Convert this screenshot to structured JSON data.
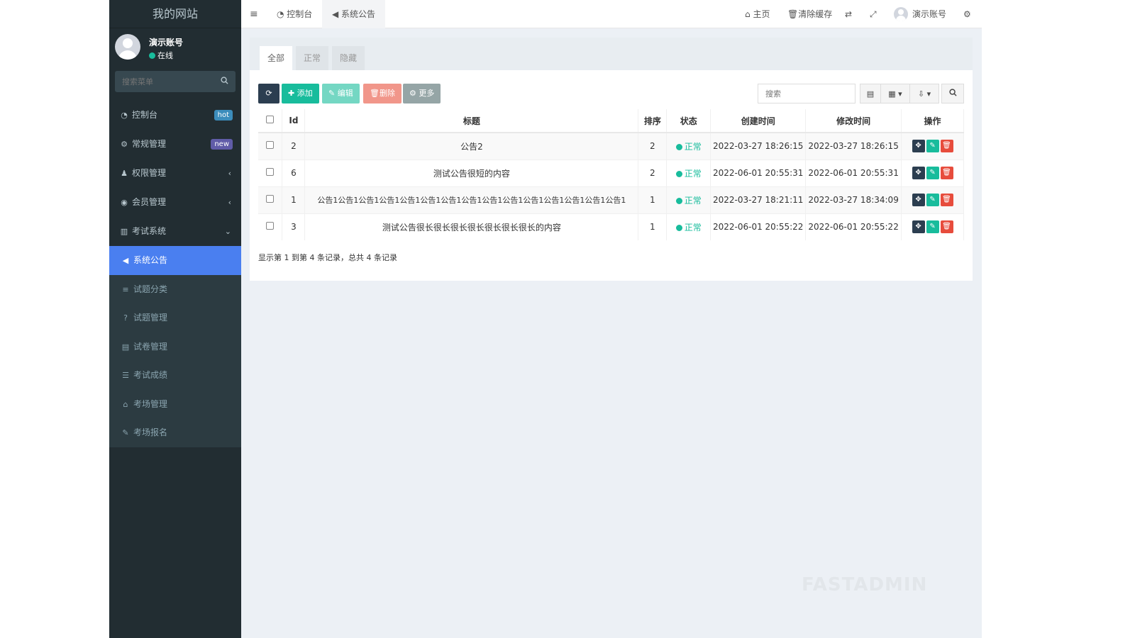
{
  "sidebar": {
    "brand": "我的网站",
    "user": {
      "name": "演示账号",
      "status": "在线"
    },
    "search_placeholder": "搜索菜单",
    "menu": [
      {
        "label": "控制台",
        "badge": "hot"
      },
      {
        "label": "常规管理",
        "badge": "new"
      },
      {
        "label": "权限管理",
        "chevron": "‹"
      },
      {
        "label": "会员管理",
        "chevron": "‹"
      },
      {
        "label": "考试系统",
        "chevron": "⌄"
      }
    ],
    "submenu": [
      {
        "label": "系统公告",
        "active": true
      },
      {
        "label": "试题分类"
      },
      {
        "label": "试题管理"
      },
      {
        "label": "试卷管理"
      },
      {
        "label": "考试成绩"
      },
      {
        "label": "考场管理"
      },
      {
        "label": "考场报名"
      }
    ]
  },
  "header": {
    "tabs": [
      "控制台",
      "系统公告"
    ],
    "home": "主页",
    "clear_cache": "清除缓存",
    "account": "演示账号"
  },
  "panel": {
    "filter_tabs": [
      "全部",
      "正常",
      "隐藏"
    ],
    "toolbar": {
      "add": "添加",
      "edit": "编辑",
      "delete": "删除",
      "more": "更多"
    },
    "search_placeholder": "搜索",
    "columns": [
      "Id",
      "标题",
      "排序",
      "状态",
      "创建时间",
      "修改时间",
      "操作"
    ],
    "rows": [
      {
        "id": "2",
        "title": "公告2",
        "sort": "2",
        "status": "正常",
        "created": "2022-03-27 18:26:15",
        "updated": "2022-03-27 18:26:15"
      },
      {
        "id": "6",
        "title": "测试公告很短的内容",
        "sort": "2",
        "status": "正常",
        "created": "2022-06-01 20:55:31",
        "updated": "2022-06-01 20:55:31"
      },
      {
        "id": "1",
        "title": "公告1公告1公告1公告1公告1公告1公告1公告1公告1公告1公告1公告1公告1公告1公告1",
        "sort": "1",
        "status": "正常",
        "created": "2022-03-27 18:21:11",
        "updated": "2022-03-27 18:34:09"
      },
      {
        "id": "3",
        "title": "测试公告很长很长很长很长很长很长很长的内容",
        "sort": "1",
        "status": "正常",
        "created": "2022-06-01 20:55:22",
        "updated": "2022-06-01 20:55:22"
      }
    ],
    "summary": "显示第 1 到第 4 条记录，总共 4 条记录"
  },
  "watermark": "FASTADMIN",
  "colors": {
    "primary": "#18bc9c",
    "active_menu": "#4a7ff0",
    "sidebar": "#222d32",
    "danger": "#e74c3c",
    "dark": "#2c3e50"
  }
}
